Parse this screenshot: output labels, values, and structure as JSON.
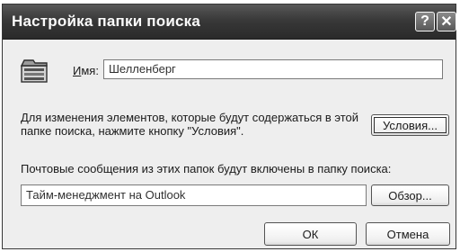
{
  "window": {
    "title": "Настройка папки поиска",
    "help_glyph": "?",
    "close_glyph": "✕"
  },
  "form": {
    "name_label_accel": "И",
    "name_label_rest": "мя:",
    "name_value": "Шелленберг",
    "description": "Для изменения элементов, которые будут содержаться в этой папке поиска, нажмите кнопку \"Условия\".",
    "conditions_button": "Условия...",
    "folders_info": "Почтовые сообщения из этих папок будут включены в папку поиска:",
    "folders_value": "Тайм-менеджмент на Outlook",
    "browse_button": "Обзор...",
    "ok_button": "ОК",
    "cancel_button": "Отмена"
  },
  "icons": {
    "folder": "search-folder-icon"
  }
}
